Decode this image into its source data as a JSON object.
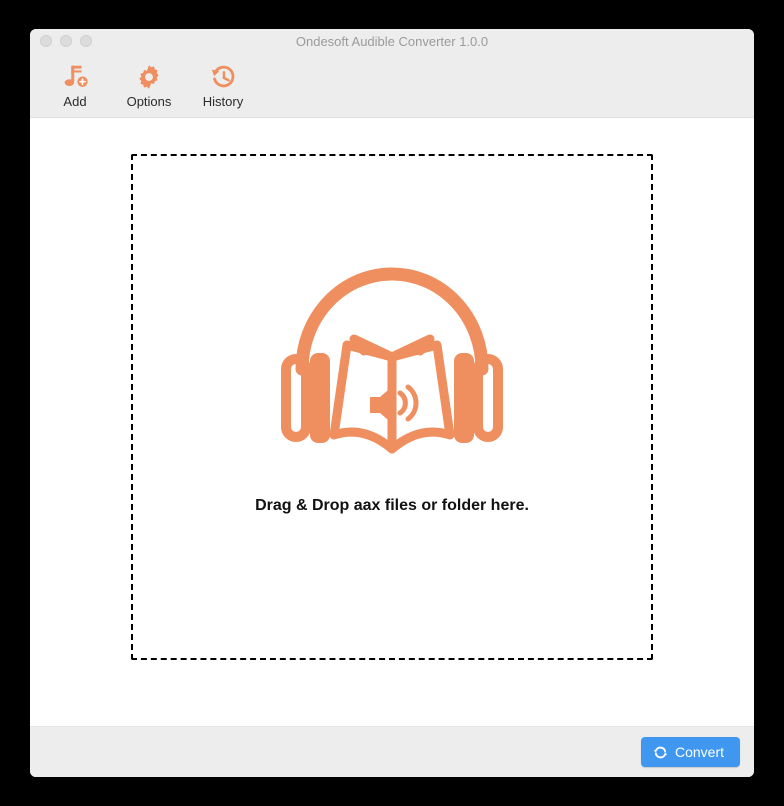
{
  "window": {
    "title": "Ondesoft Audible Converter 1.0.0"
  },
  "toolbar": {
    "add_label": "Add",
    "options_label": "Options",
    "history_label": "History"
  },
  "dropzone": {
    "hint": "Drag & Drop aax files or folder here."
  },
  "footer": {
    "convert_label": "Convert"
  },
  "colors": {
    "accent_orange": "#ef8e5e",
    "accent_blue": "#3f97f0"
  }
}
